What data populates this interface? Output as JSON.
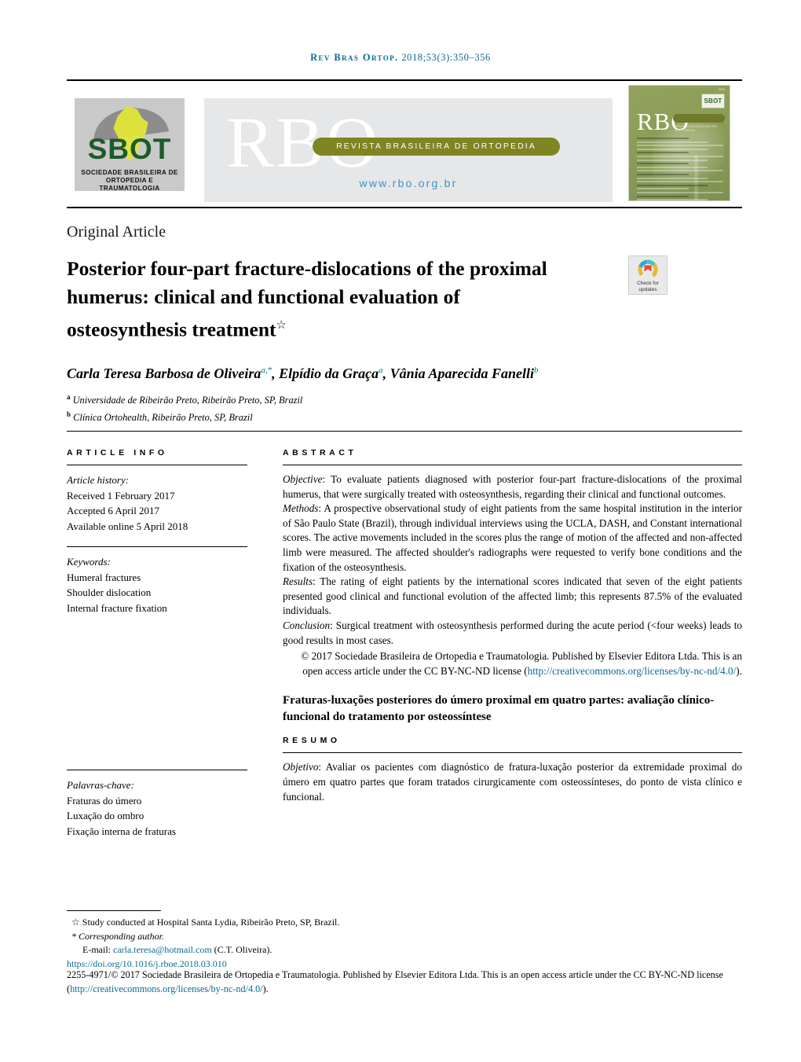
{
  "running_head": {
    "journal_abbrev": "Rev Bras Ortop.",
    "citation": " 2018;53(3):350–356"
  },
  "masthead": {
    "sbot": {
      "wordmark": "SBOT",
      "line1": "SOCIEDADE BRASILEIRA DE",
      "line2": "ORTOPEDIA E TRAUMATOLOGIA"
    },
    "rbo": {
      "wordmark": "RBO",
      "tagline": "REVISTA BRASILEIRA DE ORTOPEDIA",
      "url": "www.rbo.org.br"
    },
    "cover": {
      "wordmark": "RBO",
      "tagline": "REVISTA BRASILEIRA DE ORTOPEDIA",
      "badge": "SBOT",
      "corner_label": "ISSN"
    }
  },
  "article": {
    "type": "Original Article",
    "title": "Posterior four-part fracture-dislocations of the proximal humerus: clinical and functional evaluation of osteosynthesis treatment",
    "title_footnote_marker": "☆",
    "crossmark": {
      "line1": "Check for",
      "line2": "updates"
    },
    "authors_html": "Carla Teresa Barbosa de Oliveira, Elpídio da Graça, Vânia Aparecida Fanelli",
    "author_list": [
      {
        "name": "Carla Teresa Barbosa de Oliveira",
        "marks": "a,*"
      },
      {
        "name": "Elpídio da Graça",
        "marks": "a"
      },
      {
        "name": "Vânia Aparecida Fanelli",
        "marks": "b"
      }
    ],
    "affiliations": [
      {
        "mark": "a",
        "text": "Universidade de Ribeirão Preto, Ribeirão Preto, SP, Brazil"
      },
      {
        "mark": "b",
        "text": "Clínica Ortohealth, Ribeirão Preto, SP, Brazil"
      }
    ]
  },
  "info": {
    "heading": "ARTICLE INFO",
    "history_label": "Article history:",
    "history": [
      "Received 1 February 2017",
      "Accepted 6 April 2017",
      "Available online 5 April 2018"
    ],
    "keywords_label": "Keywords:",
    "keywords": [
      "Humeral fractures",
      "Shoulder dislocation",
      "Internal fracture fixation"
    ],
    "pt_keywords_label": "Palavras-chave:",
    "pt_keywords": [
      "Fraturas do úmero",
      "Luxação do ombro",
      "Fixação interna de fraturas"
    ]
  },
  "abstract": {
    "heading": "ABSTRACT",
    "objective_label": "Objective",
    "objective_text": ": To evaluate patients diagnosed with posterior four-part fracture-dislocations of the proximal humerus, that were surgically treated with osteosynthesis, regarding their clinical and functional outcomes.",
    "methods_label": "Methods",
    "methods_text": ": A prospective observational study of eight patients from the same hospital institution in the interior of São Paulo State (Brazil), through individual interviews using the UCLA, DASH, and Constant international scores. The active movements included in the scores plus the range of motion of the affected and non-affected limb were measured. The affected shoulder's radiographs were requested to verify bone conditions and the fixation of the osteosynthesis.",
    "results_label": "Results",
    "results_text": ": The rating of eight patients by the international scores indicated that seven of the eight patients presented good clinical and functional evolution of the affected limb; this represents 87.5% of the evaluated individuals.",
    "conclusion_label": "Conclusion",
    "conclusion_text": ": Surgical treatment with osteosynthesis performed during the acute period (<four weeks) leads to good results in most cases.",
    "copyright_prefix": "© 2017 Sociedade Brasileira de Ortopedia e Traumatologia. Published by Elsevier Editora Ltda. This is an open access article under the CC BY-NC-ND license (",
    "copyright_link": "http://creativecommons.org/licenses/by-nc-nd/4.0/",
    "copyright_suffix": ")."
  },
  "resumo": {
    "pt_title": "Fraturas-luxações posteriores do úmero proximal em quatro partes: avaliação clínico-funcional do tratamento por osteossíntese",
    "heading": "RESUMO",
    "objetivo_label": "Objetivo",
    "objetivo_text": ": Avaliar os pacientes com diagnóstico de fratura-luxação posterior da extremidade proximal do úmero em quatro partes que foram tratados cirurgicamente com osteossínteses, do ponto de vista clínico e funcional."
  },
  "footnotes": {
    "study_marker": "☆",
    "study_note": "Study conducted at Hospital Santa Lydia, Ribeirão Preto, SP, Brazil.",
    "corresponding_marker": "*",
    "corresponding_label": "Corresponding author.",
    "email_label": "E-mail:",
    "email": "carla.teresa@hotmail.com",
    "email_owner": "(C.T. Oliveira).",
    "doi": "https://doi.org/10.1016/j.rboe.2018.03.010",
    "issn_copyright_prefix": "2255-4971/© 2017 Sociedade Brasileira de Ortopedia e Traumatologia. Published by Elsevier Editora Ltda. This is an open access article under the CC BY-NC-ND license (",
    "issn_copyright_link": "http://creativecommons.org/licenses/by-nc-nd/4.0/",
    "issn_copyright_suffix": ")."
  },
  "colors": {
    "link_blue": "#0b6a93",
    "banner_olive": "#7e8521",
    "sbot_green": "#1e5b2a",
    "url_blue": "#3f93c4"
  }
}
